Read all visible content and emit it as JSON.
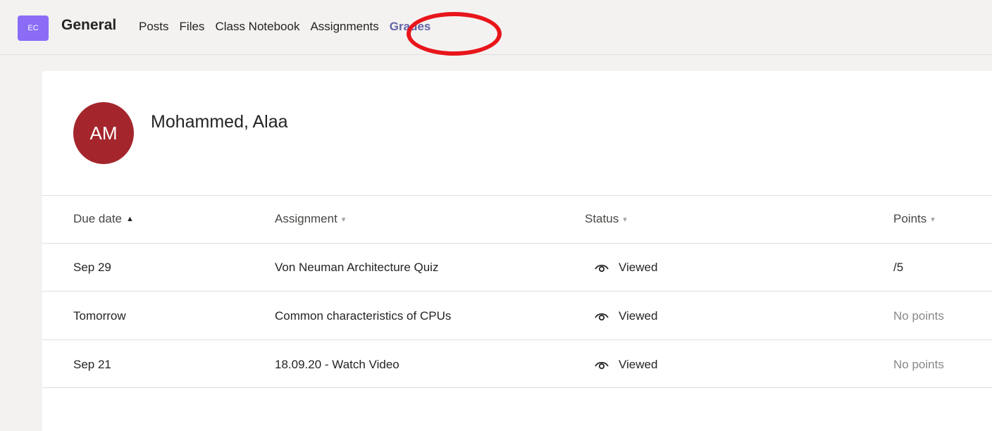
{
  "header": {
    "team_initials": "EC",
    "channel": "General",
    "tabs": [
      {
        "label": "Posts"
      },
      {
        "label": "Files"
      },
      {
        "label": "Class Notebook"
      },
      {
        "label": "Assignments"
      },
      {
        "label": "Grades",
        "active": true
      }
    ]
  },
  "student": {
    "initials": "AM",
    "name": "Mohammed, Alaa"
  },
  "table": {
    "columns": [
      "Due date",
      "Assignment",
      "Status",
      "Points"
    ],
    "rows": [
      {
        "due": "Sep 29",
        "assignment": "Von Neuman Architecture Quiz",
        "status": "Viewed",
        "points": "/5"
      },
      {
        "due": "Tomorrow",
        "assignment": "Common characteristics of CPUs",
        "status": "Viewed",
        "points": "No points"
      },
      {
        "due": "Sep 21",
        "assignment": "18.09.20 - Watch Video",
        "status": "Viewed",
        "points": "No points"
      }
    ]
  },
  "colors": {
    "accent": "#6264a7",
    "team_tile": "#8a6cf6",
    "avatar": "#a4262c",
    "highlight_ring": "#e8151b"
  },
  "icons": {
    "sort_ascending": "sort-ascending-icon",
    "sort_dropdown": "chevron-down-icon",
    "status": "eye-icon"
  }
}
